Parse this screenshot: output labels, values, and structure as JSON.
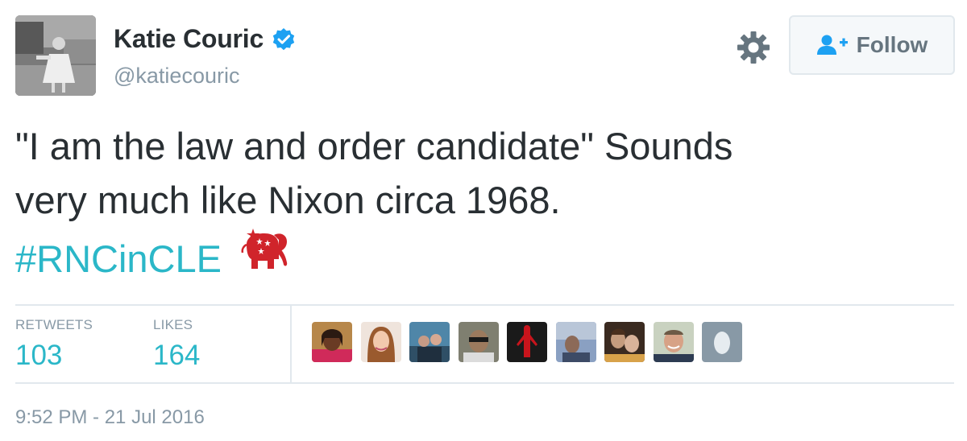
{
  "user": {
    "display_name": "Katie Couric",
    "handle": "@katiecouric",
    "verified_icon": "verified-badge-icon"
  },
  "actions": {
    "settings_icon": "gear-icon",
    "follow_label": "Follow",
    "follow_icon": "add-user-icon"
  },
  "tweet": {
    "line1": "\"I am the law and order candidate\" Sounds",
    "line2": "very much like Nixon circa 1968.",
    "hashtag": "#RNCinCLE",
    "emoji_icon": "elephant-icon"
  },
  "stats": {
    "retweets_label": "RETWEETS",
    "retweets_count": "103",
    "likes_label": "LIKES",
    "likes_count": "164"
  },
  "timestamp": "9:52 PM - 21 Jul 2016",
  "colors": {
    "link": "#2bb7c8",
    "verified": "#1da1f2",
    "muted": "#8899a6",
    "elephant": "#d0242b"
  }
}
